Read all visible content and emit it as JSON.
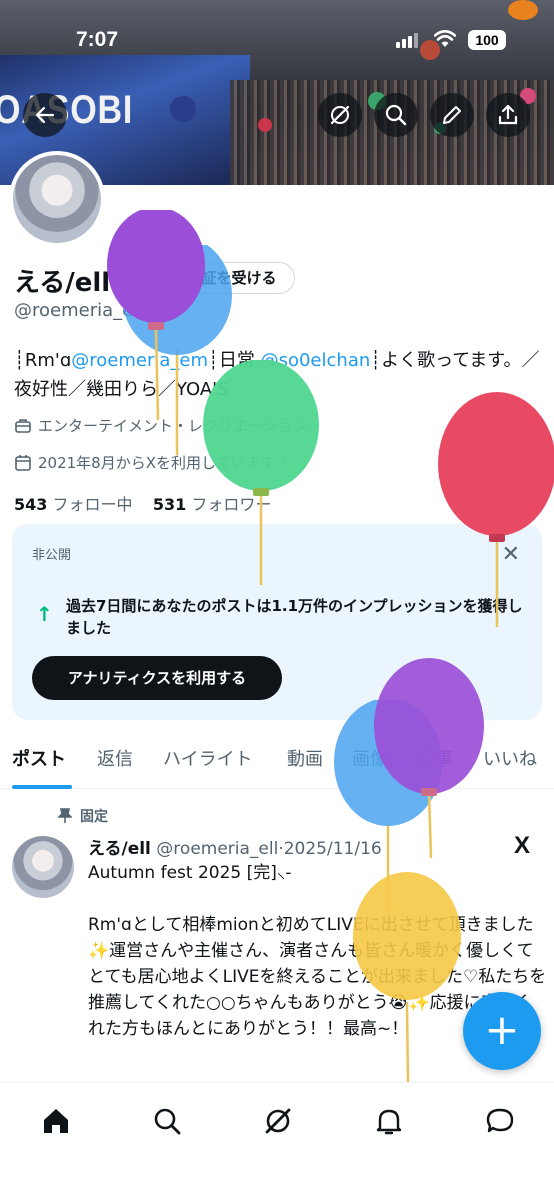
{
  "status_bar": {
    "time": "7:07",
    "battery": "100"
  },
  "banner": {
    "stage_text": "OASOBI"
  },
  "header_buttons": [
    {
      "name": "back-button",
      "icon": "arrow-left-icon"
    },
    {
      "name": "grok-button",
      "icon": "grok-icon"
    },
    {
      "name": "search-button",
      "icon": "search-icon"
    },
    {
      "name": "edit-button",
      "icon": "pencil-icon"
    },
    {
      "name": "share-button",
      "icon": "share-icon"
    }
  ],
  "profile": {
    "name": "える/ell",
    "handle": "@roemeria_ell",
    "verify_button": "認証を受ける",
    "bio": {
      "part1": "┊Rm'ɑ",
      "link1": "@roemeria_em",
      "part2": "┊日常",
      "link2": "@so0elchan",
      "part3": "┊よく歌ってます。／夜好性／幾田りら／YOA'S"
    },
    "category": "エンターテイメント・レクリエーション",
    "joined": "2021年8月からXを利用しています",
    "following_count": "543",
    "following_label": "フォロー中",
    "followers_count": "531",
    "followers_label": "フォロワー"
  },
  "private_card": {
    "tag": "非公開",
    "message": "過去7日間にあなたのポストは1.1万件のインプレッションを獲得しました",
    "cta": "アナリティクスを利用する"
  },
  "tabs": [
    "ポスト",
    "返信",
    "ハイライト",
    "動画",
    "画像",
    "記事",
    "いいね"
  ],
  "post": {
    "pinned_label": "固定",
    "author_name": "える/ell",
    "author_handle": "@roemeria_ell",
    "date": "2025/11/16",
    "body": "Autumn fest 2025 [完]⸜‐\n\nRm'ɑとして相棒mionと初めてLIVEに出させて頂きました✨運営さんや主催さん、演者さんも皆さん暖かく優しくてとても居心地よくLIVEを終えることが出来ました♡私たちを推薦してくれた○○ちゃんもありがとう😭✨応援に来てくれた方もほんとにありがとう！！最高~！"
  },
  "colors": {
    "accent": "#1d9bf0",
    "balloon_purple": "#9b4fd8",
    "balloon_blue": "#4aa3f0",
    "balloon_green": "#4fd68f",
    "balloon_red": "#e94a63",
    "balloon_yellow": "#f5c844"
  },
  "bottom_nav": [
    "home-icon",
    "search-icon",
    "grok-icon",
    "notifications-icon",
    "messages-icon"
  ]
}
